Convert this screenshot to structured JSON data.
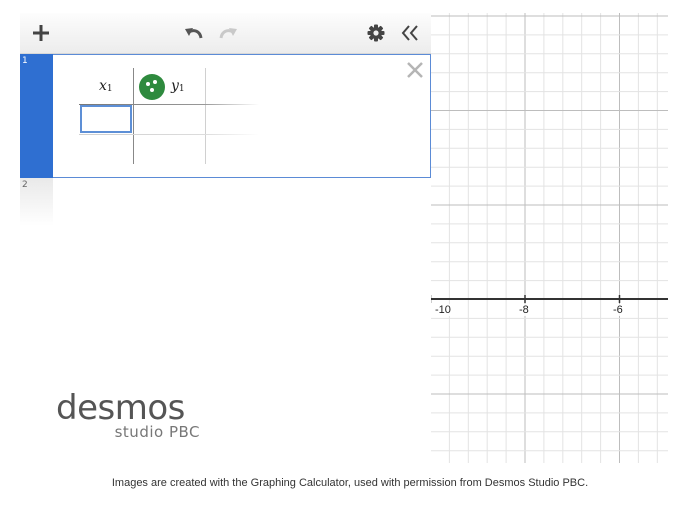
{
  "toolbar": {
    "add_icon": "plus-icon",
    "undo_icon": "undo-icon",
    "redo_icon": "redo-icon",
    "settings_icon": "gear-icon",
    "collapse_icon": "double-chevron-left-icon"
  },
  "expressions": [
    {
      "number": "1",
      "type": "table",
      "columns": [
        {
          "var": "x",
          "sub": "1"
        },
        {
          "var": "y",
          "sub": "1"
        }
      ],
      "point_style_color": "#2e8a3e",
      "active_cell_value": ""
    },
    {
      "number": "2"
    }
  ],
  "graph": {
    "x_tick_labels": [
      "-10",
      "-8",
      "-6"
    ],
    "axis_color": "#333333",
    "major_grid_color": "#bdbdbd",
    "minor_grid_color": "#e3e3e3"
  },
  "branding": {
    "logo_main": "desmos",
    "logo_sub": "studio PBC"
  },
  "caption": "Images are created with the Graphing Calculator, used with permission from Desmos Studio PBC.",
  "colors": {
    "accent": "#2f6fd1",
    "selection_border": "#5d8fd6"
  }
}
